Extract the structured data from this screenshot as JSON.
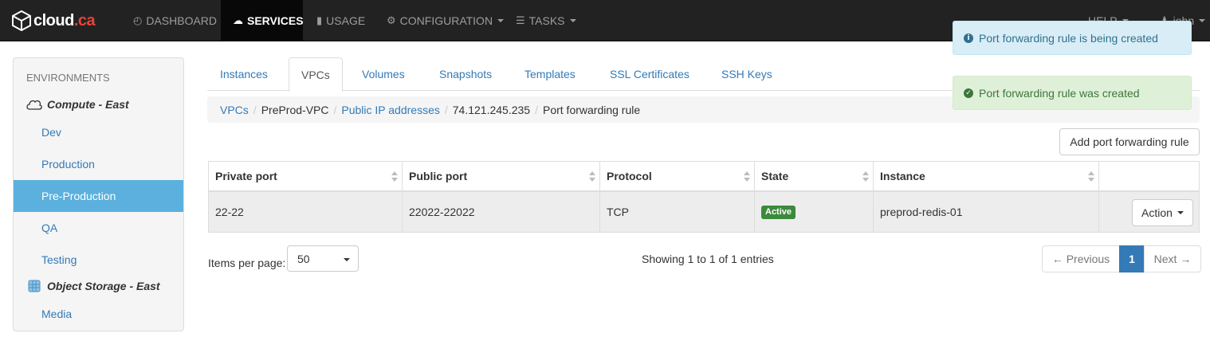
{
  "brand": {
    "name": "cloud",
    "tld": ".ca"
  },
  "nav": {
    "dashboard": "DASHBOARD",
    "services": "SERVICES",
    "usage": "USAGE",
    "configuration": "CONFIGURATION",
    "tasks": "TASKS",
    "help": "HELP",
    "user": "john"
  },
  "sidebar": {
    "header": "ENVIRONMENTS",
    "groups": [
      {
        "label": "Compute - East",
        "icon": "cloud-icon",
        "items": [
          "Dev",
          "Production",
          "Pre-Production",
          "QA",
          "Testing"
        ]
      },
      {
        "label": "Object Storage - East",
        "icon": "storage-icon",
        "items": [
          "Media"
        ]
      }
    ],
    "active_item": "Pre-Production"
  },
  "tabs": [
    "Instances",
    "VPCs",
    "Volumes",
    "Snapshots",
    "Templates",
    "SSL Certificates",
    "SSH Keys"
  ],
  "active_tab": "VPCs",
  "breadcrumb": [
    "VPCs",
    "PreProd-VPC",
    "Public IP addresses",
    "74.121.245.235",
    "Port forwarding rule"
  ],
  "add_button": "Add port forwarding rule",
  "table": {
    "headers": [
      "Private port",
      "Public port",
      "Protocol",
      "State",
      "Instance"
    ],
    "rows": [
      {
        "private_port": "22-22",
        "public_port": "22022-22022",
        "protocol": "TCP",
        "state": "Active",
        "instance": "preprod-redis-01",
        "action": "Action"
      }
    ]
  },
  "pagination": {
    "items_per_page_label": "Items per page:",
    "items_per_page": "50",
    "showing": "Showing 1 to 1 of 1 entries",
    "previous": "← Previous",
    "current_page": "1",
    "next": "Next →"
  },
  "notifications": [
    {
      "type": "info",
      "text": "Port forwarding rule is being created"
    },
    {
      "type": "success",
      "text": "Port forwarding rule was created"
    }
  ],
  "colors": {
    "navbar": "#222222",
    "link": "#337ab7",
    "active_sidebar": "#5bb0de",
    "active_badge": "#3c8a3c",
    "brand_accent": "#e8433a"
  }
}
